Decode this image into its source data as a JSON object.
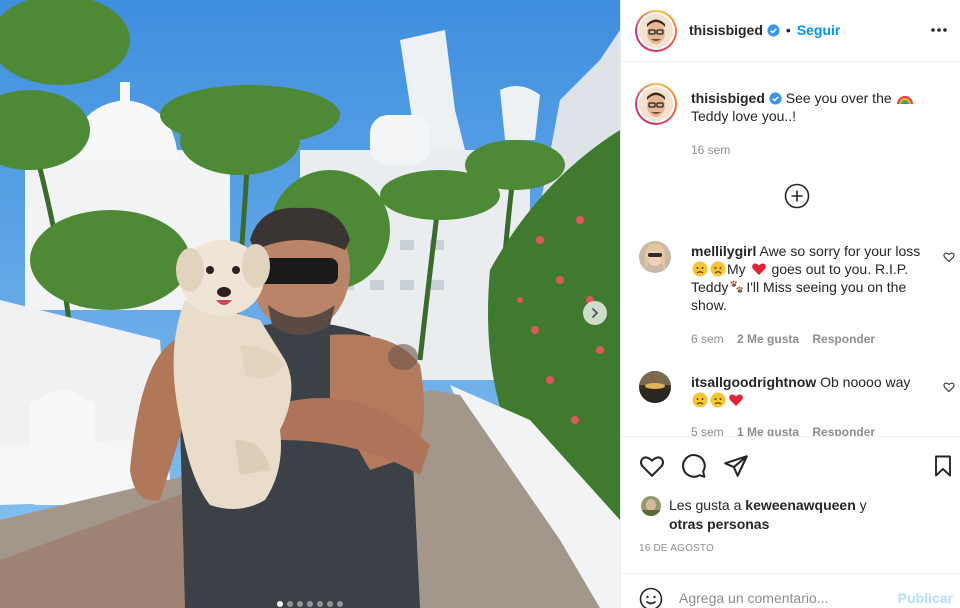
{
  "post": {
    "image_alt": "Man in sunglasses holding a small fluffy dog at a resort",
    "carousel_total": 7,
    "carousel_active": 1
  },
  "header": {
    "username": "thisisbiged",
    "separator": "•",
    "follow_label": "Seguir"
  },
  "caption": {
    "username": "thisisbiged",
    "text_line1": "See you over the",
    "text_line2": "Teddy love you..!",
    "time": "16 sem"
  },
  "comments": [
    {
      "username": "mellilygirl",
      "text_line1": "Awe so sorry for your loss",
      "text_line2_after": "My",
      "text_line2_end": "goes out to you. R.I.P.",
      "text_line3_start": "Teddy",
      "text_line3_end": "I'll Miss seeing you on the",
      "text_line4": "show.",
      "time": "6 sem",
      "likes": "2 Me gusta",
      "reply": "Responder"
    },
    {
      "username": "itsallgoodrightnow",
      "text_line1": "Ob noooo way",
      "time": "5 sem",
      "likes": "1 Me gusta",
      "reply": "Responder"
    }
  ],
  "likes": {
    "prefix": "Les gusta a",
    "user": "keweenawqueen",
    "conj": "y",
    "others": "otras personas"
  },
  "date": "16 DE AGOSTO",
  "add_comment": {
    "placeholder": "Agrega un comentario...",
    "publish": "Publicar"
  },
  "colors": {
    "link": "#0095f6",
    "muted": "#8e8e8e",
    "publish_disabled": "#b2dffc"
  }
}
